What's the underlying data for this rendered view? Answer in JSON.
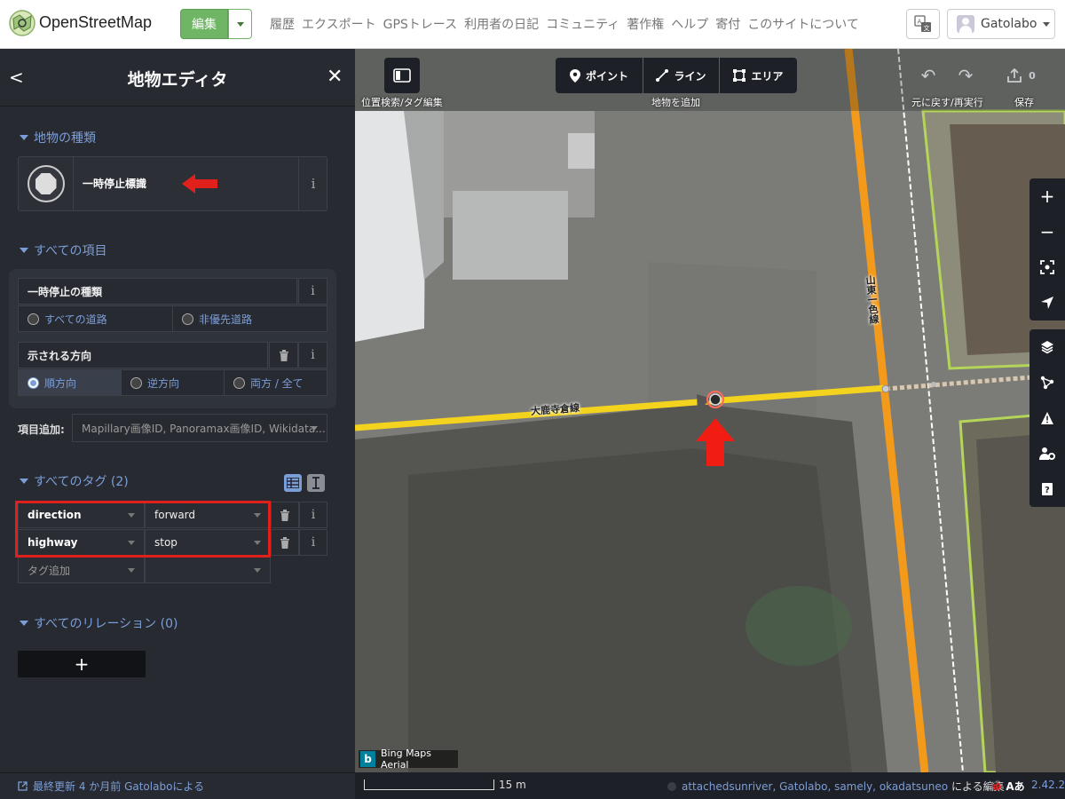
{
  "topnav": {
    "logo_text": "OpenStreetMap",
    "edit_label": "編集",
    "links": [
      "履歴",
      "エクスポート",
      "GPSトレース",
      "利用者の日記",
      "コミュニティ",
      "著作権",
      "ヘルプ",
      "寄付",
      "このサイトについて"
    ],
    "username": "Gatolabo"
  },
  "sidebar": {
    "title": "地物エディタ",
    "feature_type_heading": "地物の種類",
    "preset_name": "一時停止標識",
    "all_fields_heading": "すべての項目",
    "fields": {
      "stop_type": {
        "label": "一時停止の種類",
        "options": [
          "すべての道路",
          "非優先道路"
        ]
      },
      "direction": {
        "label": "示される方向",
        "options": [
          "順方向",
          "逆方向",
          "両方 / 全て"
        ],
        "selected": "順方向"
      }
    },
    "add_field_label": "項目追加:",
    "add_field_placeholder": "Mapillary画像ID, Panoramax画像ID, Wikidata...",
    "tags_heading": "すべてのタグ (2)",
    "tags": [
      {
        "key": "direction",
        "value": "forward"
      },
      {
        "key": "highway",
        "value": "stop"
      }
    ],
    "add_tag_placeholder": "タグ追加",
    "relations_heading": "すべてのリレーション (0)",
    "add_relation_label": "+",
    "footer": "最終更新 4 か月前 Gatolaboによる"
  },
  "map": {
    "toolbar": {
      "search_label": "位置検索/タグ編集",
      "add_feature_label": "地物を追加",
      "point": "ポイント",
      "line": "ライン",
      "area": "エリア",
      "undo_redo_label": "元に戻す/再実行",
      "save_label": "保存",
      "save_count": "0"
    },
    "road_label_1": "大鹿寺倉線",
    "road_label_2": "山東一色線",
    "imagery": "Bing Maps Aerial",
    "scale": "15 m",
    "credits_names": "attachedsunriver, Gatolabo, samely, okadatsuneo",
    "credits_suffix": " による編集",
    "issue_label": "Aあ",
    "version": "2.42.2"
  },
  "colors": {
    "accent": "#7c9ed8",
    "edit_green": "#6fb565",
    "highlight_red": "#e0211b",
    "road_yellow": "#f4d31e",
    "road_orange": "#f39a1b"
  }
}
